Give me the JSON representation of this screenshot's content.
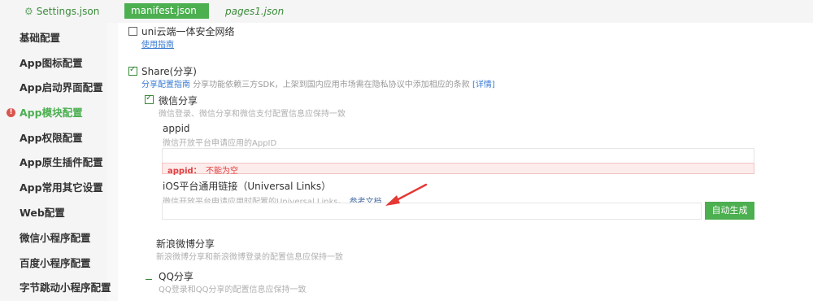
{
  "tabs": {
    "settings": "Settings.json",
    "manifest": "manifest.json",
    "pages": "pages1.json"
  },
  "sidebar": {
    "items": [
      {
        "label": "基础配置"
      },
      {
        "label": "App图标配置"
      },
      {
        "label": "App启动界面配置"
      },
      {
        "label": "App模块配置"
      },
      {
        "label": "App权限配置"
      },
      {
        "label": "App原生插件配置"
      },
      {
        "label": "App常用其它设置"
      },
      {
        "label": "Web配置"
      },
      {
        "label": "微信小程序配置"
      },
      {
        "label": "百度小程序配置"
      },
      {
        "label": "字节跳动小程序配置"
      }
    ],
    "active_warn": "!"
  },
  "main": {
    "uni_secure": {
      "label": "uni云端一体安全网络",
      "link": "使用指南"
    },
    "share": {
      "label": "Share(分享)",
      "guide_link": "分享配置指南",
      "desc": "分享功能依赖三方SDK，上架到国内应用市场需在隐私协议中添加相应的条款",
      "detail_link": "[详情]"
    },
    "weixin": {
      "label": "微信分享",
      "desc": "微信登录、微信分享和微信支付配置信息应保持一致"
    },
    "appid": {
      "label": "appid",
      "desc": "微信开放平台申请应用的AppID",
      "value": "",
      "error_key": "appid：",
      "error_msg": "不能为空"
    },
    "ios_links": {
      "label": "iOS平台通用链接（Universal Links）",
      "desc": "微信开放平台申请应用时配置的Universal Links。",
      "doc_link": "参考文档",
      "value": "",
      "button": "自动生成"
    },
    "sina": {
      "label": "新浪微博分享",
      "desc": "新浪微博分享和新浪微博登录的配置信息应保持一致"
    },
    "qq": {
      "label": "QQ分享",
      "desc": "QQ登录和QQ分享的配置信息应保持一致"
    }
  },
  "colors": {
    "accent": "#4caf50",
    "error": "#e04040",
    "link": "#3a7bd5",
    "annotation_arrow": "#e53935"
  }
}
